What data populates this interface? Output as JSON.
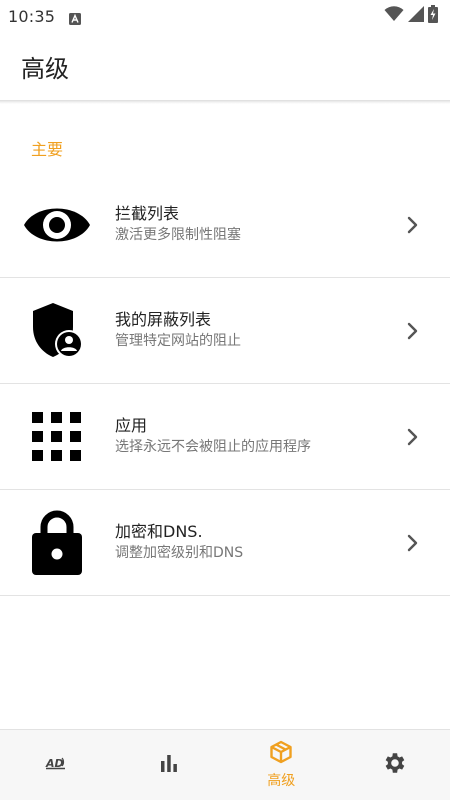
{
  "status_bar": {
    "time": "10:35",
    "icons": [
      "notification-a-icon",
      "wifi-icon",
      "signal-icon",
      "battery-charging-icon"
    ]
  },
  "app_bar": {
    "title": "高级"
  },
  "section": {
    "header": "主要"
  },
  "menu": {
    "items": [
      {
        "icon": "eye-icon",
        "title": "拦截列表",
        "subtitle": "激活更多限制性阻塞"
      },
      {
        "icon": "shield-user-icon",
        "title": "我的屏蔽列表",
        "subtitle": "管理特定网站的阻止"
      },
      {
        "icon": "grid-icon",
        "title": "应用",
        "subtitle": "选择永远不会被阻止的应用程序"
      },
      {
        "icon": "lock-icon",
        "title": "加密和DNS.",
        "subtitle": "调整加密级别和DNS"
      }
    ]
  },
  "bottom_nav": {
    "items": [
      {
        "icon": "ad-block-icon",
        "label": "",
        "active": false
      },
      {
        "icon": "stats-icon",
        "label": "",
        "active": false
      },
      {
        "icon": "box-icon",
        "label": "高级",
        "active": true
      },
      {
        "icon": "gear-icon",
        "label": "",
        "active": false
      }
    ]
  },
  "colors": {
    "accent": "#f0a020",
    "icon": "#000000",
    "chevron": "#555555",
    "inactive_nav": "#444444"
  }
}
